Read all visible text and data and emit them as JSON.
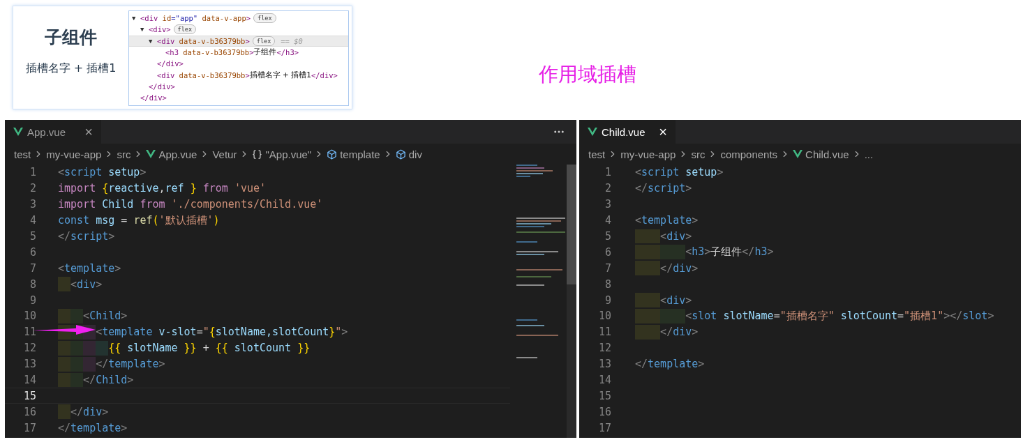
{
  "preview": {
    "heading": "子组件",
    "text": "插槽名字 + 插槽1"
  },
  "devtools": {
    "rows": [
      {
        "selected": false,
        "tokens": [
          {
            "t": "▼",
            "kind": "toggle"
          },
          {
            "t": "<div",
            "kind": "tag"
          },
          {
            "t": " id",
            "kind": "attr"
          },
          {
            "t": "=\"app\"",
            "kind": "value"
          },
          {
            "t": " data-v-app",
            "kind": "attr"
          },
          {
            "t": ">",
            "kind": "tag"
          },
          {
            "t": "flex",
            "kind": "badge"
          }
        ],
        "children": [
          {
            "selected": false,
            "tokens": [
              {
                "t": "▼",
                "kind": "toggle"
              },
              {
                "t": "<div>",
                "kind": "tag"
              },
              {
                "t": "flex",
                "kind": "badge"
              }
            ],
            "children": [
              {
                "selected": true,
                "tokens": [
                  {
                    "t": "▼",
                    "kind": "toggle"
                  },
                  {
                    "t": "<div",
                    "kind": "tag"
                  },
                  {
                    "t": " data-v-b36379bb",
                    "kind": "attr"
                  },
                  {
                    "t": ">",
                    "kind": "tag"
                  },
                  {
                    "t": "flex",
                    "kind": "badge"
                  },
                  {
                    "t": "== $0",
                    "kind": "ref"
                  }
                ],
                "children": [
                  {
                    "selected": false,
                    "tokens": [
                      {
                        "t": "<h3",
                        "kind": "tag"
                      },
                      {
                        "t": " data-v-b36379bb",
                        "kind": "attr"
                      },
                      {
                        "t": ">",
                        "kind": "tag"
                      },
                      {
                        "t": "子组件",
                        "kind": "text"
                      },
                      {
                        "t": "</h3>",
                        "kind": "tag"
                      }
                    ]
                  }
                ]
              },
              {
                "selected": false,
                "tokens": [
                  {
                    "t": "</div>",
                    "kind": "tag"
                  }
                ]
              },
              {
                "selected": false,
                "tokens": [
                  {
                    "t": "<div",
                    "kind": "tag"
                  },
                  {
                    "t": " data-v-b36379bb",
                    "kind": "attr"
                  },
                  {
                    "t": ">",
                    "kind": "tag"
                  },
                  {
                    "t": "插槽名字 + 插槽1",
                    "kind": "text"
                  },
                  {
                    "t": "</div>",
                    "kind": "tag"
                  }
                ]
              }
            ]
          },
          {
            "selected": false,
            "tokens": [
              {
                "t": "</div>",
                "kind": "tag"
              }
            ]
          }
        ]
      },
      {
        "selected": false,
        "tokens": [
          {
            "t": "</div>",
            "kind": "tag"
          }
        ]
      }
    ]
  },
  "title": "作用域插槽",
  "editors": [
    {
      "tab": {
        "label": "App.vue",
        "selected": false,
        "close": "×"
      },
      "more": true,
      "breadcrumbs": [
        {
          "label": "test",
          "kind": "text"
        },
        {
          "label": "my-vue-app",
          "kind": "text"
        },
        {
          "label": "src",
          "kind": "text"
        },
        {
          "label": "App.vue",
          "kind": "vue"
        },
        {
          "label": "Vetur",
          "kind": "text"
        },
        {
          "label": "\"App.vue\"",
          "kind": "braces"
        },
        {
          "label": "template",
          "kind": "cube"
        },
        {
          "label": "div",
          "kind": "cube"
        }
      ],
      "lines": [
        {
          "number": "1",
          "current": false,
          "tokens": [
            {
              "t": "<",
              "kind": "punct"
            },
            {
              "t": "script",
              "kind": "tag"
            },
            {
              "t": " setup",
              "kind": "attr"
            },
            {
              "t": ">",
              "kind": "punct"
            }
          ]
        },
        {
          "number": "2",
          "current": false,
          "tokens": [
            {
              "t": "import ",
              "kind": "keyword"
            },
            {
              "t": "{",
              "kind": "brace"
            },
            {
              "t": "reactive",
              "kind": "var"
            },
            {
              "t": ",",
              "kind": "plain"
            },
            {
              "t": "ref ",
              "kind": "var"
            },
            {
              "t": "}",
              "kind": "brace"
            },
            {
              "t": " from ",
              "kind": "keyword"
            },
            {
              "t": "'vue'",
              "kind": "string"
            }
          ]
        },
        {
          "number": "3",
          "current": false,
          "tokens": [
            {
              "t": "import ",
              "kind": "keyword"
            },
            {
              "t": "Child",
              "kind": "var"
            },
            {
              "t": " from ",
              "kind": "keyword"
            },
            {
              "t": "'./components/Child.vue'",
              "kind": "string"
            }
          ]
        },
        {
          "number": "4",
          "current": false,
          "tokens": [
            {
              "t": "const ",
              "kind": "tag"
            },
            {
              "t": "msg",
              "kind": "var"
            },
            {
              "t": " = ",
              "kind": "plain"
            },
            {
              "t": "ref",
              "kind": "func"
            },
            {
              "t": "(",
              "kind": "brace"
            },
            {
              "t": "'默认插槽'",
              "kind": "string"
            },
            {
              "t": ")",
              "kind": "brace"
            }
          ]
        },
        {
          "number": "5",
          "current": false,
          "tokens": [
            {
              "t": "</",
              "kind": "punct"
            },
            {
              "t": "script",
              "kind": "tag"
            },
            {
              "t": ">",
              "kind": "punct"
            }
          ]
        },
        {
          "number": "6",
          "current": false
        },
        {
          "number": "7",
          "current": false,
          "tokens": [
            {
              "t": "<",
              "kind": "punct"
            },
            {
              "t": "template",
              "kind": "tag"
            },
            {
              "t": ">",
              "kind": "punct"
            }
          ]
        },
        {
          "number": "8",
          "current": false,
          "guides": [
            {
              "color": "#33331f"
            }
          ],
          "tokens": [
            {
              "t": "<",
              "kind": "punct"
            },
            {
              "t": "div",
              "kind": "tag"
            },
            {
              "t": ">",
              "kind": "punct"
            }
          ]
        },
        {
          "number": "9",
          "current": false
        },
        {
          "number": "10",
          "current": false,
          "guides": [
            {
              "color": "#33331f"
            },
            {
              "color": "#263023"
            }
          ],
          "tokens": [
            {
              "t": "<",
              "kind": "punct"
            },
            {
              "t": "Child",
              "kind": "tag"
            },
            {
              "t": ">",
              "kind": "punct"
            }
          ]
        },
        {
          "number": "11",
          "current": false,
          "guides": [
            {
              "color": "#33331f"
            },
            {
              "color": "#263023"
            },
            {
              "color": "#332633"
            }
          ],
          "tokens": [
            {
              "t": "<",
              "kind": "punct"
            },
            {
              "t": "template",
              "kind": "tag"
            },
            {
              "t": " v-slot",
              "kind": "attr"
            },
            {
              "t": "=",
              "kind": "plain"
            },
            {
              "t": "\"",
              "kind": "string"
            },
            {
              "t": "{",
              "kind": "brace"
            },
            {
              "t": "slotName,slotCount",
              "kind": "var"
            },
            {
              "t": "}",
              "kind": "brace"
            },
            {
              "t": "\"",
              "kind": "string"
            },
            {
              "t": ">",
              "kind": "punct"
            }
          ]
        },
        {
          "number": "12",
          "current": false,
          "guides": [
            {
              "color": "#33331f"
            },
            {
              "color": "#263023"
            },
            {
              "color": "#332633"
            },
            {
              "color": "#233330"
            }
          ],
          "tokens": [
            {
              "t": "{{",
              "kind": "brace"
            },
            {
              "t": " slotName ",
              "kind": "var"
            },
            {
              "t": "}}",
              "kind": "brace"
            },
            {
              "t": " + ",
              "kind": "plain"
            },
            {
              "t": "{{",
              "kind": "brace"
            },
            {
              "t": " slotCount ",
              "kind": "var"
            },
            {
              "t": "}}",
              "kind": "brace"
            }
          ]
        },
        {
          "number": "13",
          "current": false,
          "guides": [
            {
              "color": "#33331f"
            },
            {
              "color": "#263023"
            },
            {
              "color": "#332633"
            }
          ],
          "tokens": [
            {
              "t": "</",
              "kind": "punct"
            },
            {
              "t": "template",
              "kind": "tag"
            },
            {
              "t": ">",
              "kind": "punct"
            }
          ]
        },
        {
          "number": "14",
          "current": false,
          "guides": [
            {
              "color": "#33331f"
            },
            {
              "color": "#263023"
            }
          ],
          "tokens": [
            {
              "t": "</",
              "kind": "punct"
            },
            {
              "t": "Child",
              "kind": "tag"
            },
            {
              "t": ">",
              "kind": "punct"
            }
          ]
        },
        {
          "number": "15",
          "current": true
        },
        {
          "number": "16",
          "current": false,
          "guides": [
            {
              "color": "#33331f"
            }
          ],
          "tokens": [
            {
              "t": "</",
              "kind": "punct"
            },
            {
              "t": "div",
              "kind": "tag"
            },
            {
              "t": ">",
              "kind": "punct"
            }
          ]
        },
        {
          "number": "17",
          "current": false,
          "tokens": [
            {
              "t": "</",
              "kind": "punct"
            },
            {
              "t": "template",
              "kind": "tag"
            },
            {
              "t": ">",
              "kind": "punct"
            }
          ]
        }
      ]
    },
    {
      "tab": {
        "label": "Child.vue",
        "selected": true,
        "close": "×"
      },
      "more": false,
      "breadcrumbs": [
        {
          "label": "test",
          "kind": "text"
        },
        {
          "label": "my-vue-app",
          "kind": "text"
        },
        {
          "label": "src",
          "kind": "text"
        },
        {
          "label": "components",
          "kind": "text"
        },
        {
          "label": "Child.vue",
          "kind": "vue"
        },
        {
          "label": "...",
          "kind": "text"
        }
      ],
      "lines": [
        {
          "number": "1",
          "current": false,
          "tokens": [
            {
              "t": "<",
              "kind": "punct"
            },
            {
              "t": "script",
              "kind": "tag"
            },
            {
              "t": " setup",
              "kind": "attr"
            },
            {
              "t": ">",
              "kind": "punct"
            }
          ]
        },
        {
          "number": "2",
          "current": false,
          "tokens": [
            {
              "t": "</",
              "kind": "punct"
            },
            {
              "t": "script",
              "kind": "tag"
            },
            {
              "t": ">",
              "kind": "punct"
            }
          ]
        },
        {
          "number": "3",
          "current": false
        },
        {
          "number": "4",
          "current": false,
          "tokens": [
            {
              "t": "<",
              "kind": "punct"
            },
            {
              "t": "template",
              "kind": "tag"
            },
            {
              "t": ">",
              "kind": "punct"
            }
          ]
        },
        {
          "number": "5",
          "current": false,
          "guides": [
            {
              "color": "#33331f"
            }
          ],
          "tokens": [
            {
              "t": "<",
              "kind": "punct"
            },
            {
              "t": "div",
              "kind": "tag"
            },
            {
              "t": ">",
              "kind": "punct"
            }
          ]
        },
        {
          "number": "6",
          "current": false,
          "guides": [
            {
              "color": "#33331f"
            },
            {
              "color": "#263023"
            }
          ],
          "tokens": [
            {
              "t": "<",
              "kind": "punct"
            },
            {
              "t": "h3",
              "kind": "tag"
            },
            {
              "t": ">",
              "kind": "punct"
            },
            {
              "t": "子组件",
              "kind": "plain"
            },
            {
              "t": "</",
              "kind": "punct"
            },
            {
              "t": "h3",
              "kind": "tag"
            },
            {
              "t": ">",
              "kind": "punct"
            }
          ]
        },
        {
          "number": "7",
          "current": false,
          "guides": [
            {
              "color": "#33331f"
            }
          ],
          "tokens": [
            {
              "t": "</",
              "kind": "punct"
            },
            {
              "t": "div",
              "kind": "tag"
            },
            {
              "t": ">",
              "kind": "punct"
            }
          ]
        },
        {
          "number": "8",
          "current": false
        },
        {
          "number": "9",
          "current": false,
          "guides": [
            {
              "color": "#33331f"
            }
          ],
          "tokens": [
            {
              "t": "<",
              "kind": "punct"
            },
            {
              "t": "div",
              "kind": "tag"
            },
            {
              "t": ">",
              "kind": "punct"
            }
          ]
        },
        {
          "number": "10",
          "current": false,
          "guides": [
            {
              "color": "#33331f"
            },
            {
              "color": "#263023"
            }
          ],
          "tokens": [
            {
              "t": "<",
              "kind": "punct"
            },
            {
              "t": "slot",
              "kind": "tag"
            },
            {
              "t": " slotName",
              "kind": "attr"
            },
            {
              "t": "=",
              "kind": "plain"
            },
            {
              "t": "\"插槽名字\"",
              "kind": "string"
            },
            {
              "t": " slotCount",
              "kind": "attr"
            },
            {
              "t": "=",
              "kind": "plain"
            },
            {
              "t": "\"插槽1\"",
              "kind": "string"
            },
            {
              "t": "></",
              "kind": "punct"
            },
            {
              "t": "slot",
              "kind": "tag"
            },
            {
              "t": ">",
              "kind": "punct"
            }
          ]
        },
        {
          "number": "11",
          "current": false,
          "guides": [
            {
              "color": "#33331f"
            }
          ],
          "tokens": [
            {
              "t": "</",
              "kind": "punct"
            },
            {
              "t": "div",
              "kind": "tag"
            },
            {
              "t": ">",
              "kind": "punct"
            }
          ]
        },
        {
          "number": "12",
          "current": false
        },
        {
          "number": "13",
          "current": false,
          "tokens": [
            {
              "t": "</",
              "kind": "punct"
            },
            {
              "t": "template",
              "kind": "tag"
            },
            {
              "t": ">",
              "kind": "punct"
            }
          ]
        },
        {
          "number": "14",
          "current": false
        },
        {
          "number": "15",
          "current": false
        },
        {
          "number": "16",
          "current": false
        },
        {
          "number": "17",
          "current": false
        }
      ]
    }
  ]
}
